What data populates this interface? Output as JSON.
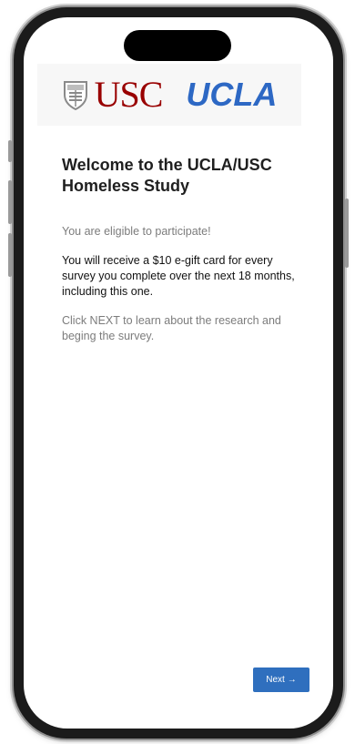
{
  "header": {
    "usc_logo_text": "USC",
    "ucla_logo_text": "UCLA"
  },
  "welcome": {
    "title": "Welcome to the UCLA/USC Homeless Study",
    "eligible": "You are eligible to participate!",
    "gift_card": "You will receive a $10 e-gift card for every survey you complete over the next 18 months, including this one.",
    "instructions": "Click NEXT to learn about the research and beging the survey."
  },
  "actions": {
    "next_label": "Next",
    "next_arrow": "→"
  },
  "colors": {
    "usc_cardinal": "#990000",
    "ucla_blue": "#2d68c4",
    "button_blue": "#2f6fbe"
  }
}
